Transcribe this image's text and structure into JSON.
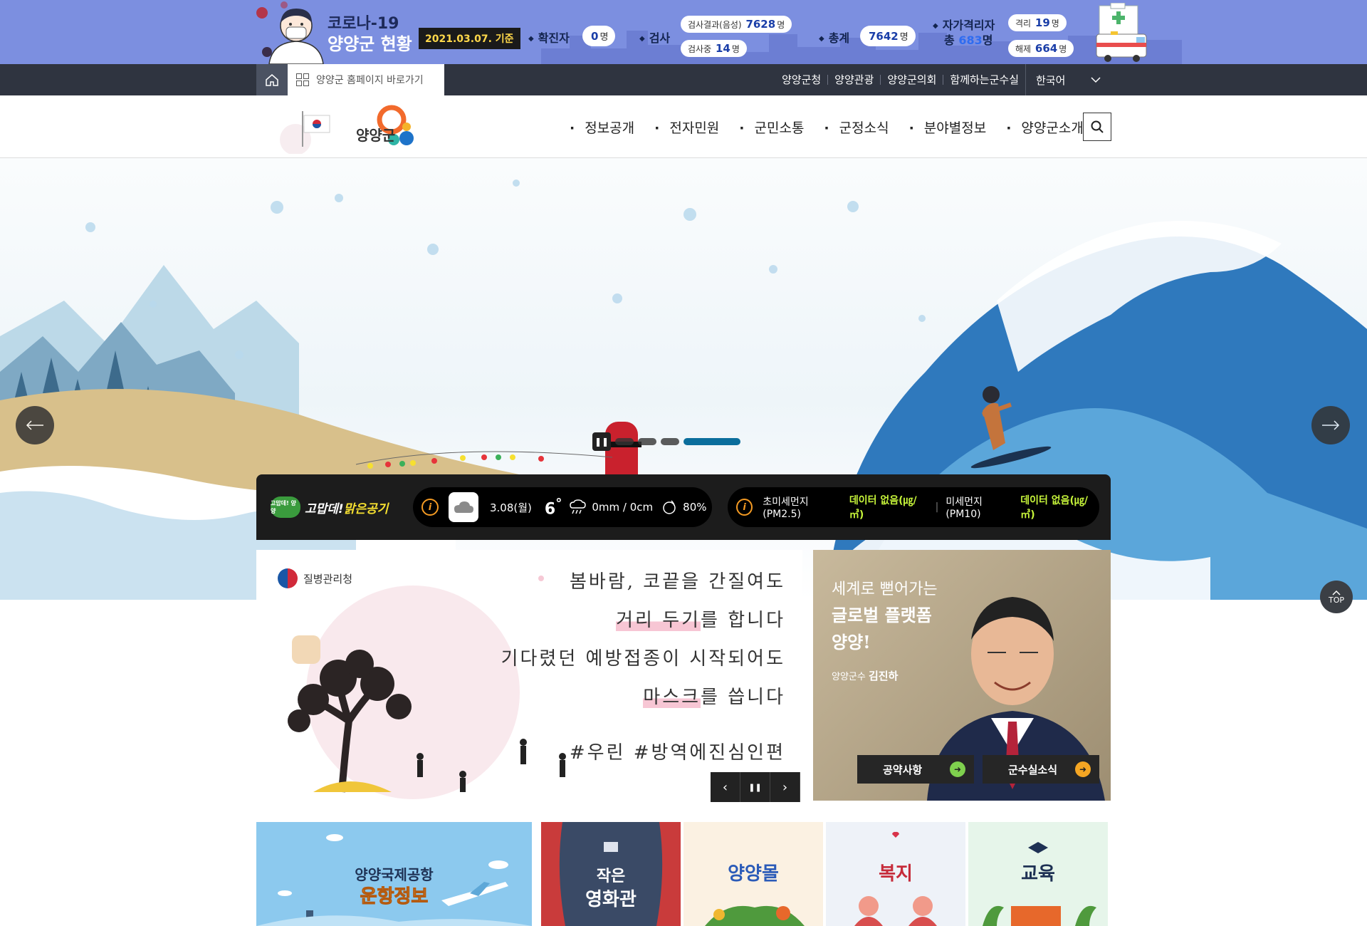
{
  "covid": {
    "title": "코로나-19",
    "subtitle": "양양군 현황",
    "date": "2021.03.07. 기준",
    "confirmed_label": "확진자",
    "confirmed_value": "0",
    "unit": "명",
    "test_label": "검사",
    "test_negative_label": "검사결과(음성)",
    "test_negative_value": "7628",
    "testing_label": "검사중",
    "testing_value": "14",
    "total_label": "총계",
    "total_value": "7642",
    "self_quarantine_label": "자가격리자",
    "self_quarantine_total_prefix": "총",
    "self_quarantine_total_value": "683",
    "isolated_label": "격리",
    "isolated_value": "19",
    "released_label": "해제",
    "released_value": "664"
  },
  "util": {
    "shortcut_label": "양양군 홈페이지 바로가기",
    "links": [
      "양양군청",
      "양양관광",
      "양양군의회",
      "함께하는군수실"
    ],
    "language": "한국어"
  },
  "header": {
    "logo_text": "양양군",
    "nav": [
      "정보공개",
      "전자민원",
      "군민소통",
      "군정소식",
      "분야별정보",
      "양양군소개"
    ]
  },
  "weather": {
    "brand_prefix": "고맙데!",
    "brand_highlight": "맑은공기",
    "brand_badge": "고맙데! 양양",
    "date": "3.08(월)",
    "temp": "6",
    "temp_unit": "°",
    "precip": "0mm / 0cm",
    "humidity": "80%",
    "pm25_label": "초미세먼지(PM2.5)",
    "pm25_value": "데이터 없음(㎍/㎥)",
    "pm10_label": "미세먼지(PM10)",
    "pm10_value": "데이터 없음(㎍/㎥)"
  },
  "notice": {
    "org": "질병관리청",
    "line1": "봄바람, 코끝을 간질여도",
    "line2_mark": "거리 두기",
    "line2_rest": "를 합니다",
    "line3": "기다렸던 예방접종이 시작되어도",
    "line4_mark": "마스크",
    "line4_rest": "를 씁니다",
    "line5": "#우린 #방역에진심인편"
  },
  "mayor": {
    "slogan1": "세계로 뻗어가는",
    "slogan2": "글로벌 플랫폼",
    "slogan3": "양양!",
    "title_prefix": "양양군수",
    "name": "김진하",
    "btn1": "공약사항",
    "btn2": "군수실소식"
  },
  "top_label": "TOP",
  "tiles": {
    "airport_line1": "양양국제공항",
    "airport_line2": "운항정보",
    "cinema_line1": "작은",
    "cinema_line2": "영화관",
    "mall": "양양몰",
    "welfare": "복지",
    "education": "교육"
  },
  "colors": {
    "covid_bg": "#7c8fe0",
    "util_bg": "#2f3440",
    "accent_blue": "#0b6e9c",
    "dust_green": "#c6f43a",
    "info_orange": "#f59b23"
  }
}
